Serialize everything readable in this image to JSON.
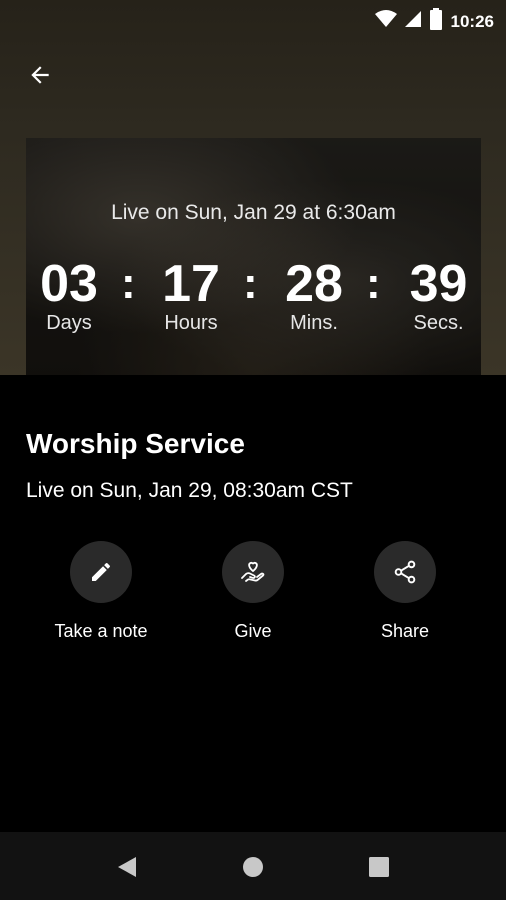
{
  "status_bar": {
    "time": "10:26",
    "icons": [
      "wifi-icon",
      "signal-icon",
      "battery-icon"
    ]
  },
  "header": {
    "back_icon": "arrow-left-icon"
  },
  "hero": {
    "live_text": "Live on Sun, Jan 29 at 6:30am",
    "countdown": [
      {
        "value": "03",
        "label": "Days"
      },
      {
        "value": "17",
        "label": "Hours"
      },
      {
        "value": "28",
        "label": "Mins."
      },
      {
        "value": "39",
        "label": "Secs."
      }
    ],
    "separator": ":"
  },
  "event": {
    "title": "Worship Service",
    "subtitle": "Live on Sun, Jan 29, 08:30am CST"
  },
  "actions": [
    {
      "label": "Take a note",
      "icon": "pencil-icon"
    },
    {
      "label": "Give",
      "icon": "heart-hand-icon"
    },
    {
      "label": "Share",
      "icon": "share-icon"
    }
  ],
  "nav_bar": {
    "icons": [
      "back-triangle-icon",
      "home-circle-icon",
      "recents-square-icon"
    ]
  },
  "colors": {
    "background": "#000000",
    "action_circle": "#2a2a2a",
    "nav_bar": "#121212"
  }
}
